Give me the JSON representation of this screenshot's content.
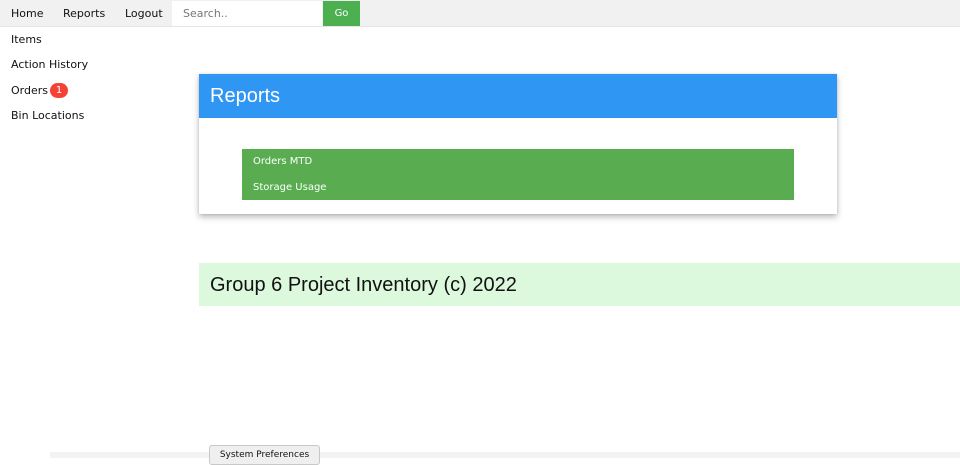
{
  "topnav": {
    "links": [
      {
        "label": "Home"
      },
      {
        "label": "Reports"
      },
      {
        "label": "Logout"
      }
    ],
    "search": {
      "placeholder": "Search..",
      "value": ""
    },
    "go_label": "Go"
  },
  "sidebar": {
    "items": [
      {
        "label": "Items"
      },
      {
        "label": "Action History"
      },
      {
        "label": "Orders",
        "badge": "1"
      },
      {
        "label": "Bin Locations"
      }
    ]
  },
  "reports_card": {
    "title": "Reports",
    "links": [
      {
        "label": "Orders MTD"
      },
      {
        "label": "Storage Usage"
      }
    ]
  },
  "footer": {
    "text": "Group 6 Project Inventory (c) 2022"
  },
  "system_preferences": {
    "label": "System Preferences"
  },
  "colors": {
    "nav_background": "#f1f1f1",
    "go_button": "#4caf50",
    "badge": "#f44336",
    "card_header": "#2f96f3",
    "report_list": "#59ad50",
    "footer_background": "#ddf9dd"
  },
  "icons": []
}
